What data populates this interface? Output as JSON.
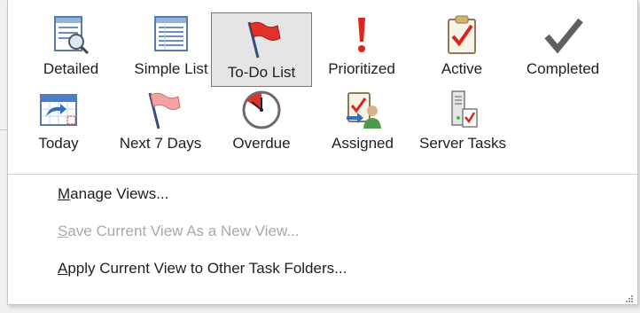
{
  "views": [
    {
      "label": "Detailed",
      "icon": "detailed-view-icon"
    },
    {
      "label": "Simple List",
      "icon": "simple-list-icon"
    },
    {
      "label": "To-Do List",
      "icon": "red-flag-icon"
    },
    {
      "label": "Prioritized",
      "icon": "exclamation-icon"
    },
    {
      "label": "Active",
      "icon": "clipboard-check-icon"
    },
    {
      "label": "Completed",
      "icon": "checkmark-icon"
    },
    {
      "label": "Today",
      "icon": "calendar-arrow-icon"
    },
    {
      "label": "Next 7 Days",
      "icon": "pink-flag-icon"
    },
    {
      "label": "Overdue",
      "icon": "clock-icon"
    },
    {
      "label": "Assigned",
      "icon": "assigned-user-icon"
    },
    {
      "label": "Server Tasks",
      "icon": "server-tasks-icon"
    }
  ],
  "selected_view": "To-Do List",
  "menu": {
    "manage_views": {
      "mnemonic": "M",
      "rest": "anage Views..."
    },
    "save_current_view": {
      "mnemonic": "S",
      "rest": "ave Current View As a New View..."
    },
    "apply_current_view": {
      "mnemonic": "A",
      "rest": "pply Current View to Other Task Folders..."
    }
  }
}
